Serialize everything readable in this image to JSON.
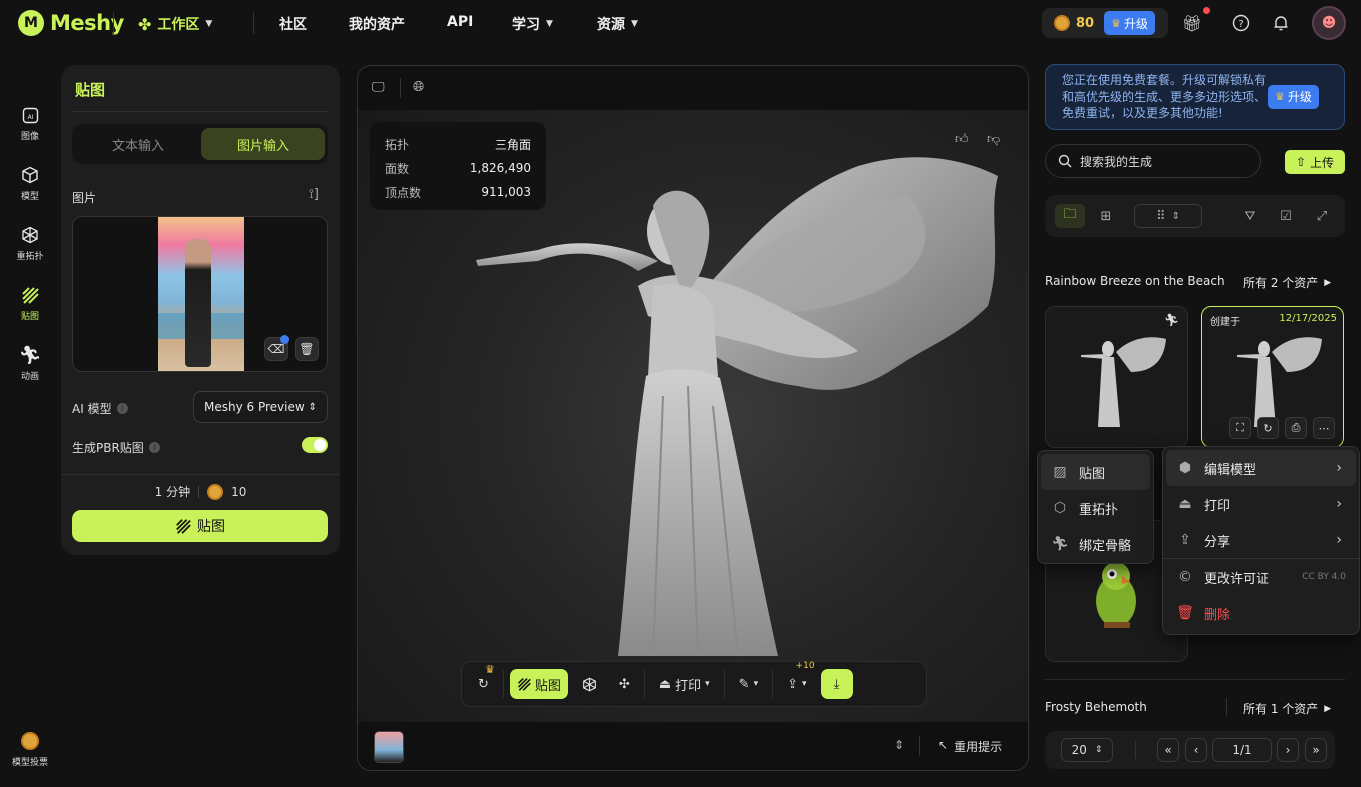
{
  "brand": {
    "name": "Meshy"
  },
  "nav": {
    "workspace": "工作区",
    "community": "社区",
    "assets": "我的资产",
    "api": "API",
    "learn": "学习",
    "resources": "资源"
  },
  "header": {
    "credits": "80",
    "upgrade": "升级"
  },
  "rail": [
    {
      "label": "图像",
      "icon": "ai-image-icon"
    },
    {
      "label": "模型",
      "icon": "cube-icon"
    },
    {
      "label": "重拓扑",
      "icon": "retopology-icon"
    },
    {
      "label": "贴图",
      "icon": "texture-icon"
    },
    {
      "label": "动画",
      "icon": "running-icon"
    }
  ],
  "rail_bottom": {
    "label": "模型投票"
  },
  "left_panel": {
    "title": "贴图",
    "tab_text": "文本输入",
    "tab_image": "图片输入",
    "image_label": "图片",
    "ai_model_label": "AI 模型",
    "ai_model_value": "Meshy 6 Preview",
    "pbr_label": "生成PBR贴图",
    "pbr_enabled": true,
    "time_cost": "1 分钟",
    "credit_cost": "10",
    "generate_label": "贴图"
  },
  "stats": [
    {
      "key": "拓扑",
      "value": "三角面"
    },
    {
      "key": "面数",
      "value": "1,826,490"
    },
    {
      "key": "顶点数",
      "value": "911,003"
    }
  ],
  "toolbar": {
    "texture": "贴图",
    "print": "打印",
    "share_badge": "+10"
  },
  "viewer_bottom": {
    "reuse": "重用提示"
  },
  "promo": {
    "text": "您正在使用免费套餐。升级可解锁私有和高优先级的生成、更多多边形选项、免费重试，以及更多其他功能!",
    "button": "升级"
  },
  "search": {
    "placeholder": "搜索我的生成",
    "upload": "上传"
  },
  "groups": [
    {
      "title": "Rainbow Breeze on the Beach",
      "count": "所有 2 个资产"
    },
    {
      "title": "Frosty Behemoth",
      "count": "所有 1 个资产"
    }
  ],
  "card2": {
    "created_label": "创建于",
    "date": "12/17/2025"
  },
  "menu_left": [
    {
      "label": "贴图",
      "icon": "texture-icon"
    },
    {
      "label": "重拓扑",
      "icon": "retopology-icon"
    },
    {
      "label": "绑定骨骼",
      "icon": "rig-icon"
    }
  ],
  "menu_right": [
    {
      "label": "编辑模型",
      "icon": "cube-icon"
    },
    {
      "label": "打印",
      "icon": "print-icon"
    },
    {
      "label": "分享",
      "icon": "share-icon"
    },
    {
      "label": "更改许可证",
      "icon": "license-icon",
      "note": "CC BY 4.0"
    },
    {
      "label": "删除",
      "icon": "trash-icon"
    }
  ],
  "pager": {
    "size": "20",
    "page": "1/1"
  },
  "colors": {
    "accent": "#c9f25a",
    "blue": "#3d7cf0",
    "danger": "#ff4d4d"
  }
}
